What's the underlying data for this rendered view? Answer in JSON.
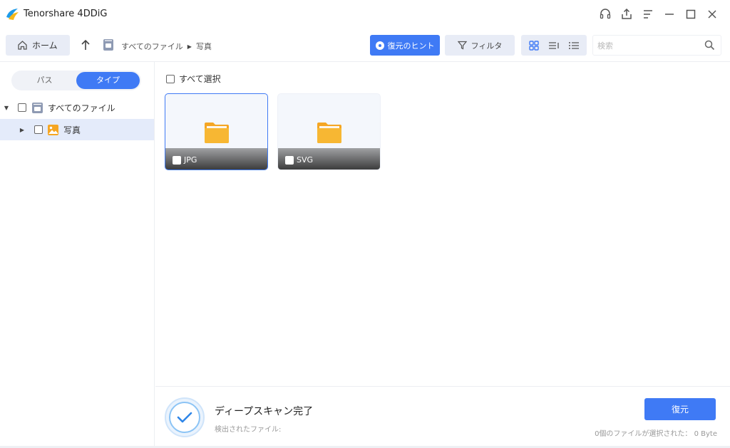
{
  "app": {
    "title": "Tenorshare 4DDiG"
  },
  "window_controls": [
    {
      "name": "support-icon"
    },
    {
      "name": "share-icon"
    },
    {
      "name": "menu-icon"
    },
    {
      "name": "minimize-icon"
    },
    {
      "name": "maximize-icon"
    },
    {
      "name": "close-icon"
    }
  ],
  "toolbar": {
    "home_label": "ホーム",
    "breadcrumb": [
      "すべてのファイル",
      "写真"
    ],
    "hint_label": "復元のヒント",
    "filter_label": "フィルタ",
    "search_placeholder": "検索"
  },
  "sidebar": {
    "tabs": [
      "パス",
      "タイプ"
    ],
    "active_tab": "タイプ",
    "tree": [
      {
        "label": "すべてのファイル",
        "expanded": true,
        "selected": false
      },
      {
        "label": "写真",
        "expanded": false,
        "selected": true
      }
    ]
  },
  "main": {
    "select_all_label": "すべて選択",
    "folders": [
      {
        "label": "JPG",
        "selected": true
      },
      {
        "label": "SVG",
        "selected": false
      }
    ]
  },
  "bottom": {
    "scan_title": "ディープスキャン完了",
    "scan_sub": "検出されたファイル:",
    "restore_label": "復元",
    "selection_info": "0個のファイルが選択された： 0 Byte"
  },
  "colors": {
    "accent": "#3f7af5",
    "folder": "#f5a623"
  }
}
